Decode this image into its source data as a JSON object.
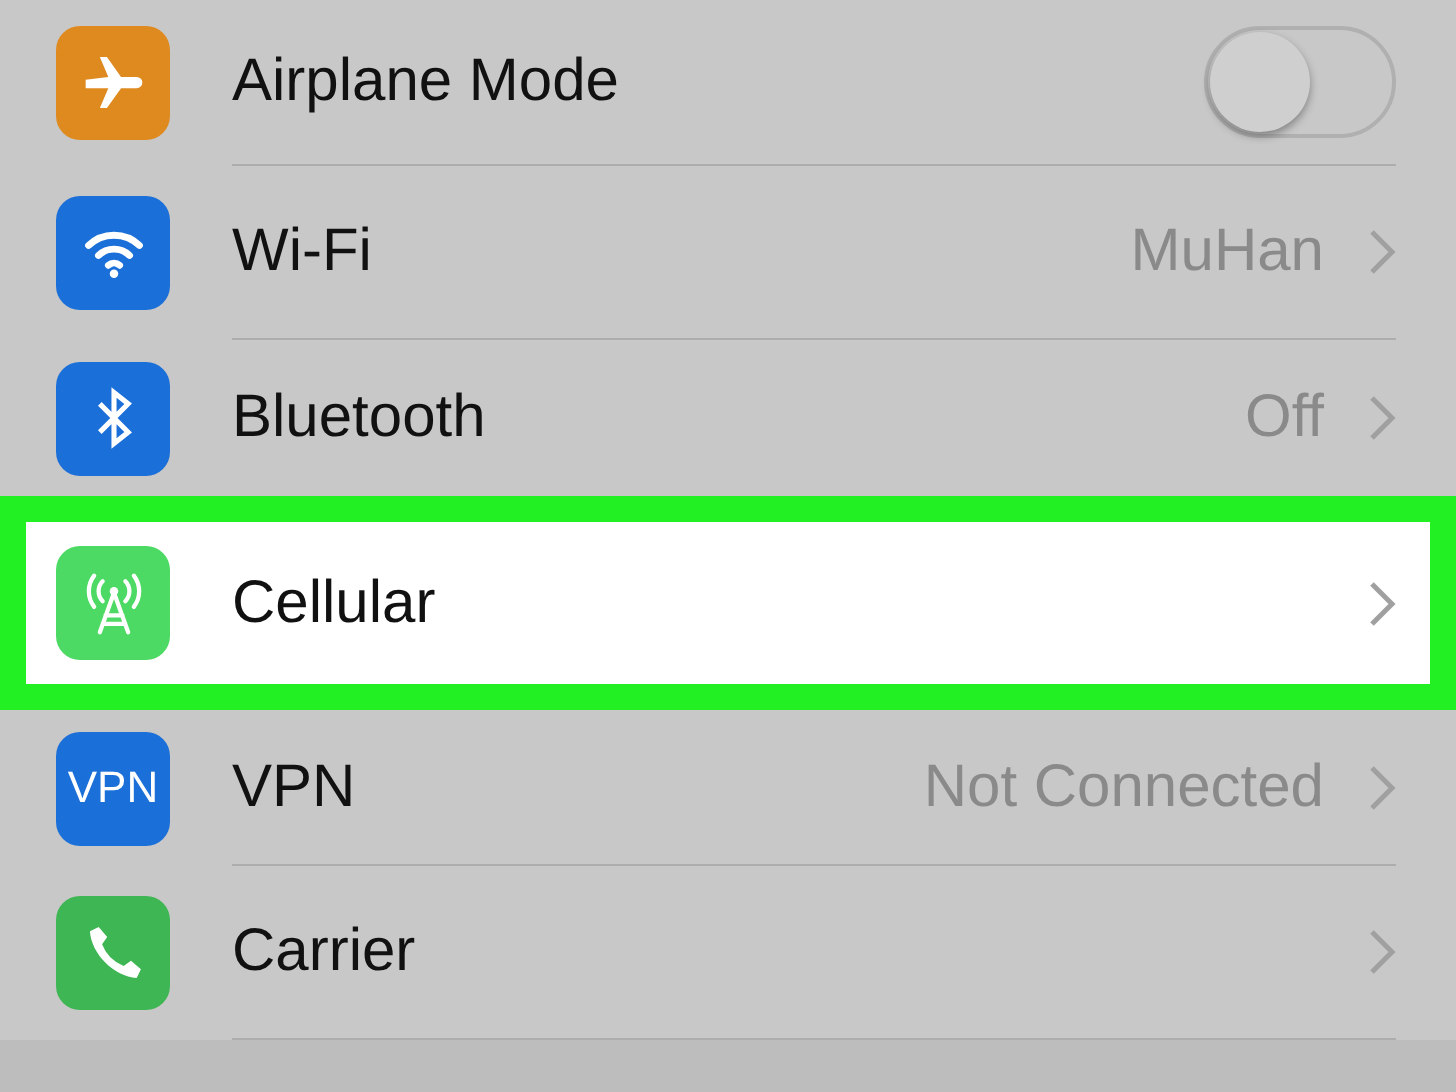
{
  "rows": [
    {
      "kind": "toggle",
      "label": "Airplane Mode",
      "on": false,
      "highlighted": false,
      "color": "#df8a1f"
    },
    {
      "kind": "link",
      "label": "Wi-Fi",
      "value": "MuHan",
      "highlighted": false,
      "color": "#1b6fd8"
    },
    {
      "kind": "link",
      "label": "Bluetooth",
      "value": "Off",
      "highlighted": false,
      "color": "#1b6fd8"
    },
    {
      "kind": "link",
      "label": "Cellular",
      "highlighted": true,
      "color": "#4cd964"
    },
    {
      "kind": "link",
      "label": "VPN",
      "value": "Not Connected",
      "highlighted": false,
      "color": "#1b6fd8",
      "icon_text": "VPN"
    },
    {
      "kind": "link",
      "label": "Carrier",
      "highlighted": false,
      "color": "#3fb654"
    }
  ]
}
